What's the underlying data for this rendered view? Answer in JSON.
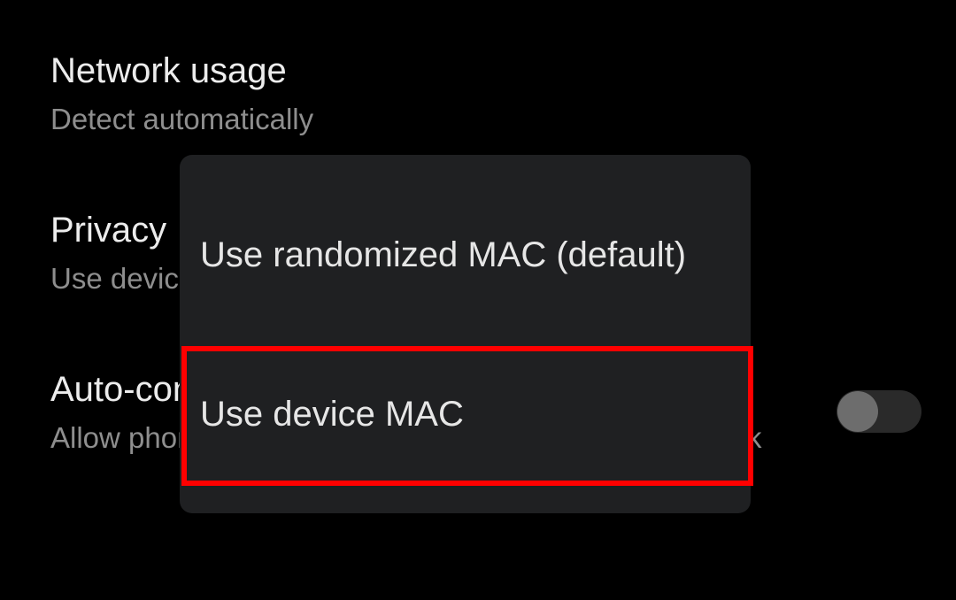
{
  "settings": {
    "network_usage": {
      "title": "Network usage",
      "summary": "Detect automatically"
    },
    "privacy": {
      "title": "Privacy",
      "summary": "Use device MAC"
    },
    "auto_connect": {
      "title": "Auto-connect",
      "summary": "Allow phone to automatically connect near this network",
      "toggle_on": false
    }
  },
  "dialog": {
    "options": [
      {
        "label": "Use randomized MAC (default)",
        "selected": false
      },
      {
        "label": "Use device MAC",
        "selected": true
      }
    ]
  },
  "colors": {
    "background": "#000000",
    "dialog_bg": "#1f2022",
    "highlight": "#ff0000",
    "toggle_track": "#2a2a2a",
    "toggle_thumb": "#6d6d6d"
  }
}
